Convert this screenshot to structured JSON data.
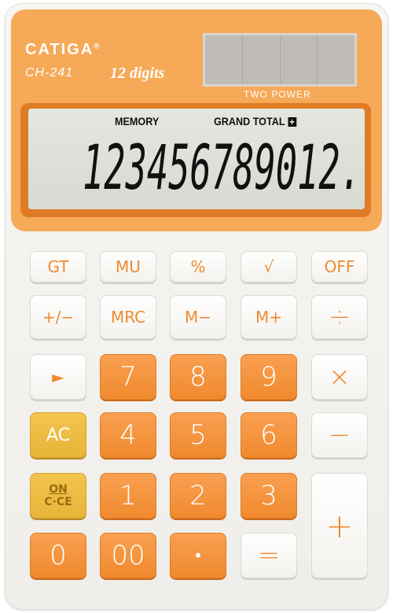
{
  "brand": {
    "name": "CATIGA",
    "trademark": "®",
    "model": "CH-241",
    "digits": "12 digits"
  },
  "solar": {
    "label": "TWO POWER"
  },
  "display": {
    "memory_label": "MEMORY",
    "grand_total_label": "GRAND TOTAL",
    "grand_total_symbol": "+",
    "reading": "123456789012."
  },
  "keys": {
    "gt": "GT",
    "mu": "MU",
    "percent": "%",
    "sqrt": "√",
    "off": "OFF",
    "plusminus": "+/−",
    "mrc": "MRC",
    "mminus": "M−",
    "mplus": "M+",
    "divide": "÷",
    "shift": "►",
    "n7": "7",
    "n8": "8",
    "n9": "9",
    "multiply": "×",
    "ac": "AC",
    "n4": "4",
    "n5": "5",
    "n6": "6",
    "minus": "−",
    "on": "ON",
    "cce": "C·CE",
    "n1": "1",
    "n2": "2",
    "n3": "3",
    "plus": "+",
    "n0": "0",
    "n00": "00",
    "dot": "•",
    "equals": "="
  },
  "colors": {
    "orange": "#f08a2e",
    "body": "#f7f6f2",
    "yellow": "#e8b43a"
  }
}
